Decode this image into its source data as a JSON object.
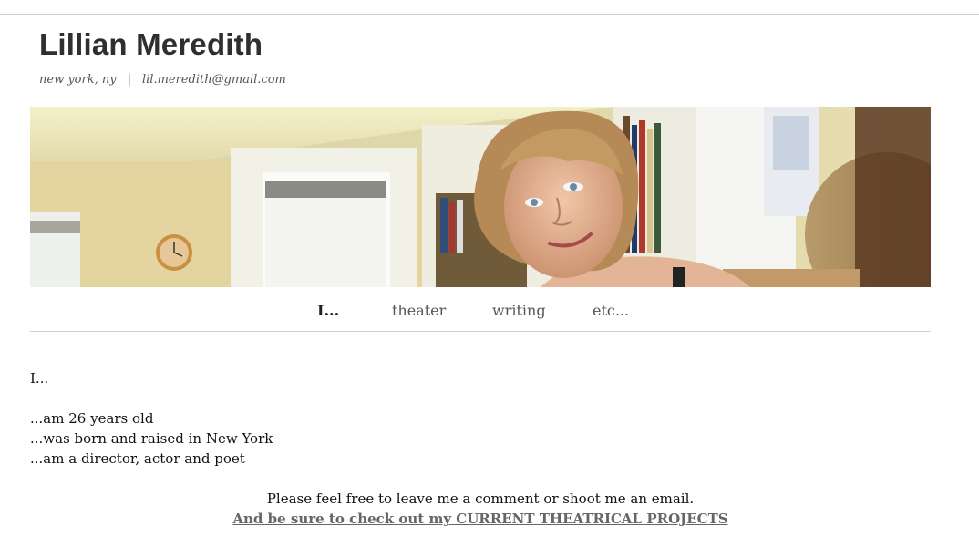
{
  "header": {
    "title": "Lillian Meredith",
    "location": "new york, ny",
    "separator": "|",
    "email": "lil.meredith@gmail.com"
  },
  "nav": {
    "items": [
      {
        "label": "I...",
        "active": true
      },
      {
        "label": "theater",
        "active": false
      },
      {
        "label": "writing",
        "active": false
      },
      {
        "label": "etc...",
        "active": false
      }
    ]
  },
  "content": {
    "intro": "I...",
    "lines": [
      "...am 26 years old",
      "...was born and raised in New York",
      "...am a director, actor and poet"
    ],
    "closing": "Please feel free to leave me a comment or shoot me an email.",
    "projects_link": "And be sure to check out my CURRENT THEATRICAL PROJECTS"
  },
  "colors": {
    "title": "#2f2f2f",
    "link": "#666666",
    "rule": "#cfcfcf"
  }
}
